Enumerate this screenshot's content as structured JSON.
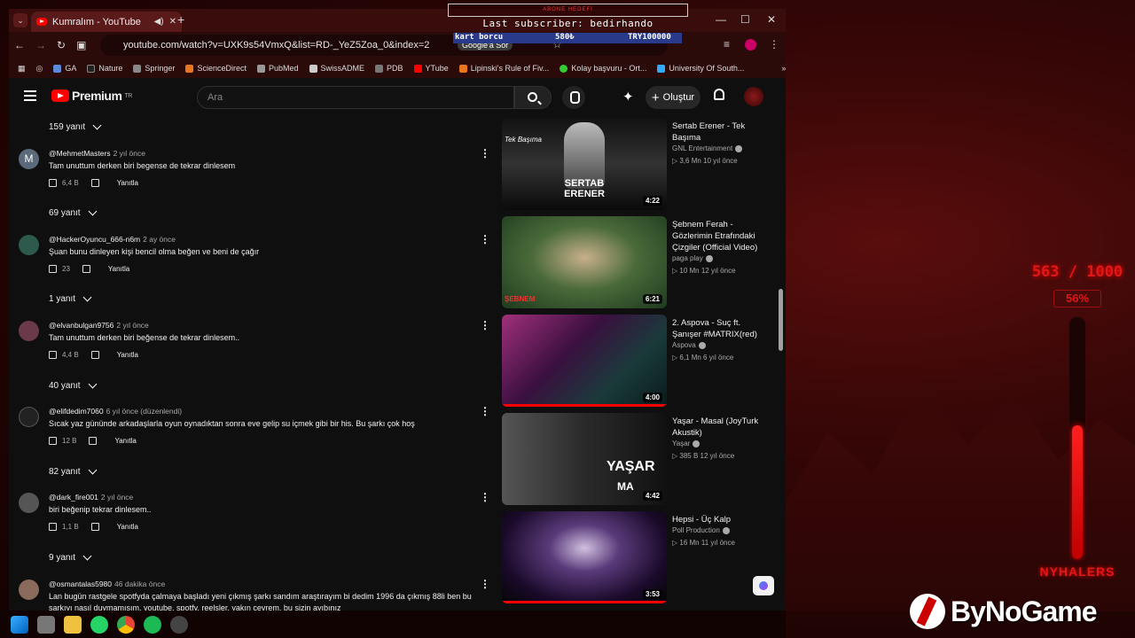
{
  "browser": {
    "tab_title": "Kumralım - YouTube",
    "url": "youtube.com/watch?v=UXK9s54VmxQ&list=RD-_YeZ5Zoa_0&index=2",
    "google_lens": "Google'a Sor",
    "bookmarks": [
      "GA",
      "Nature",
      "Springer",
      "ScienceDirect",
      "PubMed",
      "SwissADME",
      "PDB",
      "YTube",
      "Lipinski's Rule of Fiv...",
      "Kolay başvuru - Ort...",
      "University Of South..."
    ]
  },
  "header": {
    "logo": "Premium",
    "region": "TR",
    "search_placeholder": "Ara",
    "create_label": "Oluştur"
  },
  "overlay": {
    "top_banner": "ABONE HEDEFİ",
    "last_subscriber": "Last subscriber: bedirhando",
    "row_left": "kart borcu",
    "row_mid": "580₺",
    "row_right": "TRY100000"
  },
  "comments": [
    {
      "replies": "159 yanıt"
    },
    {
      "user": "@MehmetMasters",
      "time": "2 yıl önce",
      "text": "Tam unuttum derken biri begense de tekrar dinlesem",
      "likes": "6,4 B",
      "reply": "Yanıtla",
      "replies": "69 yanıt"
    },
    {
      "user": "@HackerOyuncu_666-n6m",
      "time": "2 ay önce",
      "text": "Şuan  bunu dinleyen kişi bencil olma beğen ve beni de çağır",
      "likes": "23",
      "reply": "Yanıtla",
      "replies": "1 yanıt"
    },
    {
      "user": "@elvanbulgan9756",
      "time": "2 yıl önce",
      "text": "Tam unuttum derken biri beğense de tekrar dinlesem..",
      "likes": "4,4 B",
      "reply": "Yanıtla",
      "replies": "40 yanıt"
    },
    {
      "user": "@elifdedim7060",
      "time": "6 yıl önce (düzenlendi)",
      "text": "Sıcak yaz gününde arkadaşlarla oyun oynadıktan sonra eve gelip su içmek gibi bir his. Bu şarkı çok hoş",
      "likes": "12 B",
      "reply": "Yanıtla",
      "replies": "82 yanıt"
    },
    {
      "user": "@dark_fire001",
      "time": "2 yıl önce",
      "text": "biri beğenip tekrar dinlesem..",
      "likes": "1,1 B",
      "reply": "Yanıtla",
      "replies": "9 yanıt"
    },
    {
      "user": "@osmantalas5980",
      "time": "46 dakika önce",
      "text": "Lan bugün rastgele spotfyda çalmaya başladı yeni çıkmış şarkı sandım araştırayım bi dedim 1996 da çıkmış 88li ben bu şarkıyı nasıl duymamışım, youtube, spotfy, reelsler, yakın çevrem, bu sizin ayıbınız"
    }
  ],
  "related": [
    {
      "title": "Sertab Erener - Tek Başıma",
      "channel": "GNL Entertainment",
      "meta": "3,6 Mn   10 yıl önce",
      "duration": "4:22",
      "thumb_text": "SERTAB ERENER",
      "thumb_sub": "Tek Başıma"
    },
    {
      "title": "Şebnem Ferah - Gözlerimin Etrafındaki Çizgiler (Official Video)",
      "channel": "paga play",
      "meta": "10 Mn   12 yıl önce",
      "duration": "6:21",
      "thumb_text": "ŞEBNEM"
    },
    {
      "title": "2. Aspova - Suç ft. Şanışer #MATRIX(red)",
      "channel": "Aspova",
      "meta": "6,1 Mn   6 yıl önce",
      "duration": "4:00"
    },
    {
      "title": "Yaşar - Masal (JoyTurk Akustik)",
      "channel": "Yaşar",
      "meta": "385 B   12 yıl önce",
      "duration": "4:42",
      "thumb_text": "YAŞAR",
      "thumb_sub": "MA"
    },
    {
      "title": "Hepsi - Üç Kalp",
      "channel": "Poll Production",
      "meta": "16 Mn   11 yıl önce",
      "duration": "3:53"
    }
  ],
  "goal": {
    "count": "563 / 1000",
    "percent": "56%",
    "fraction": 0.56,
    "name": "NYHALERS"
  },
  "brand": "ByNoGame",
  "colors": {
    "accent": "#ff0000",
    "goal_red": "#e01818",
    "overlay_blue": "#2a3a8a"
  }
}
